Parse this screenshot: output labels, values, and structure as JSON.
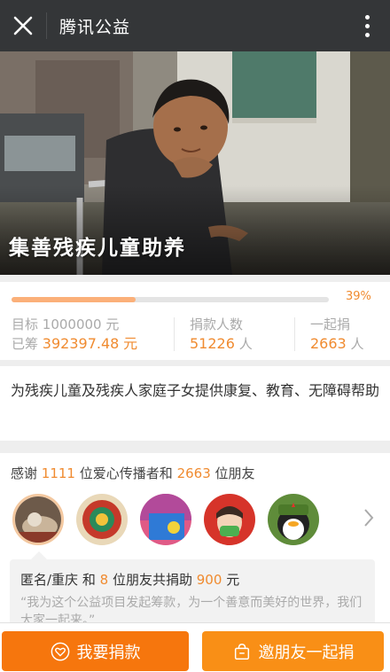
{
  "header": {
    "title": "腾讯公益",
    "close_icon": "close-icon",
    "more_icon": "more-vertical-icon"
  },
  "hero": {
    "title": "集善残疾儿童助养"
  },
  "stats": {
    "progress_fraction": 0.39,
    "progress_label": "39%",
    "target_label": "目标",
    "target_value": "1000000",
    "target_unit": "元",
    "raised_label": "已筹",
    "raised_value": "392397.48",
    "raised_unit": "元",
    "donors_label": "捐款人数",
    "donors_value": "51226",
    "donors_unit": "人",
    "together_label": "一起捐",
    "together_value": "2663",
    "together_unit": "人"
  },
  "description": "为残疾儿童及残疾人家庭子女提供康复、教育、无障碍帮助",
  "thanks": {
    "prefix": "感谢",
    "spreaders": "1111",
    "middle": "位爱心传播者和",
    "friends": "2663",
    "suffix": "位朋友",
    "chevron_icon": "chevron-right-icon"
  },
  "activity": {
    "name": "匿名/重庆",
    "and": "和",
    "count": "8",
    "middle": "位朋友共捐助",
    "amount": "900",
    "unit": "元",
    "quote": "“我为这个公益项目发起筹款，为一个善意而美好的世界，我们大家一起来。”"
  },
  "buttons": {
    "donate_label": "我要捐款",
    "donate_icon": "heart-icon",
    "invite_label": "邀朋友一起捐",
    "invite_icon": "gift-bag-icon"
  },
  "colors": {
    "accent": "#f08b30",
    "header_bg": "#343638",
    "donate_button": "#f6760d",
    "invite_button": "#f98f16",
    "progress_fill": "#fbb079"
  }
}
